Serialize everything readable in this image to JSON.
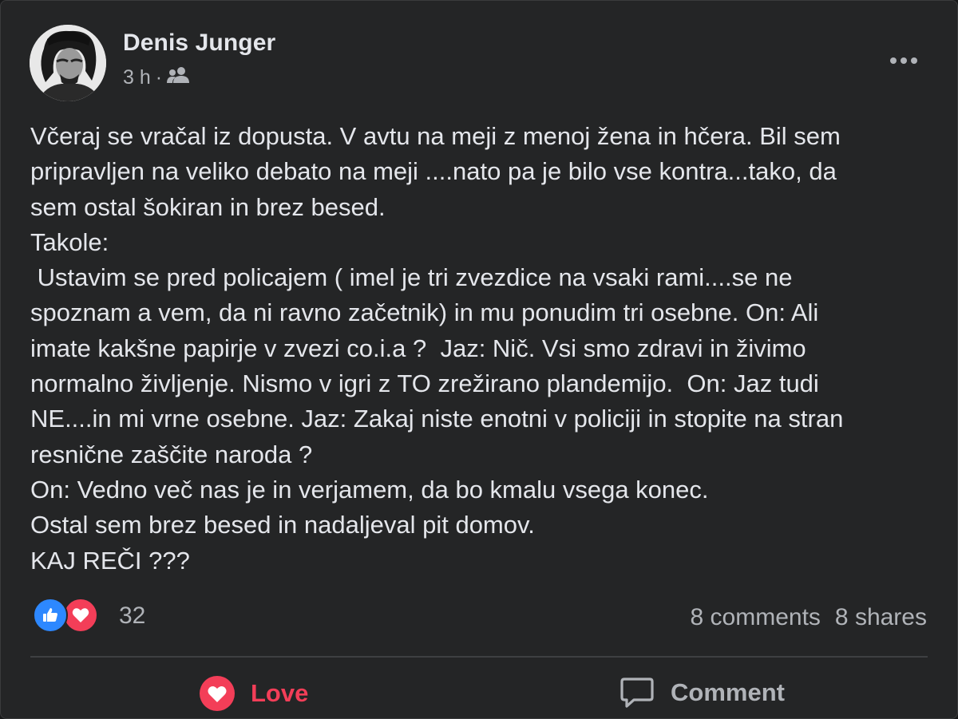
{
  "post": {
    "author": "Denis Junger",
    "time": "3 h",
    "separator": "·",
    "audience_icon": "friends-icon",
    "body": "Včeraj se vračal iz dopusta. V avtu na meji z menoj žena in hčera. Bil sem\npripravljen na veliko debato na meji ....nato pa je bilo vse kontra...tako, da\nsem ostal šokiran in brez besed.\nTakole:\n Ustavim se pred policajem ( imel je tri zvezdice na vsaki rami....se ne\nspoznam a vem, da ni ravno začetnik) in mu ponudim tri osebne. On: Ali\nimate kakšne papirje v zvezi co.i.a ?  Jaz: Nič. Vsi smo zdravi in živimo\nnormalno življenje. Nismo v igri z TO zrežirano plandemijo.  On: Jaz tudi\nNE....in mi vrne osebne. Jaz: Zakaj niste enotni v policiji in stopite na stran\nresnične zaščite naroda ?\nOn: Vedno več nas je in verjamem, da bo kmalu vsega konec.\nOstal sem brez besed in nadaljeval pit domov.\nKAJ REČI ???"
  },
  "stats": {
    "reactions": [
      "like-icon",
      "love-icon"
    ],
    "reaction_count": "32",
    "comments": "8 comments",
    "shares": "8 shares"
  },
  "actions": {
    "love_label": "Love",
    "comment_label": "Comment"
  },
  "colors": {
    "background": "#242526",
    "text": "#e4e6eb",
    "secondary": "#b0b3b8",
    "like_blue": "#2d88ff",
    "love_red": "#f33e58"
  }
}
